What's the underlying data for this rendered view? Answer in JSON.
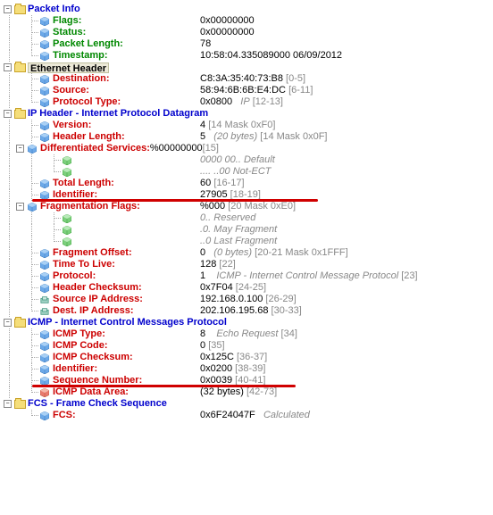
{
  "packet_info": {
    "title": "Packet Info",
    "flags": {
      "label": "Flags:",
      "value": "0x00000000"
    },
    "status": {
      "label": "Status:",
      "value": "0x00000000"
    },
    "length": {
      "label": "Packet Length:",
      "value": "78"
    },
    "ts": {
      "label": "Timestamp:",
      "value": "10:58:04.335089000 06/09/2012"
    }
  },
  "ethernet": {
    "title": "Ethernet Header",
    "dest": {
      "label": "Destination:",
      "value": "C8:3A:35:40:73:B8",
      "range": "[0-5]"
    },
    "src": {
      "label": "Source:",
      "value": "58:94:6B:6B:E4:DC",
      "range": "[6-11]"
    },
    "ptype": {
      "label": "Protocol Type:",
      "value": "0x0800",
      "extra": "IP",
      "range": "[12-13]"
    }
  },
  "ip": {
    "title": "IP Header - Internet Protocol Datagram",
    "version": {
      "label": "Version:",
      "value": "4",
      "range": "[14 Mask 0xF0]"
    },
    "hlen": {
      "label": "Header Length:",
      "value": "5",
      "extra": "(20 bytes)",
      "range": "[14 Mask 0x0F]"
    },
    "dserv": {
      "label": "Differentiated Services:",
      "value": "%00000000",
      "range": "[15]"
    },
    "ds1": {
      "bits": "0000 00..",
      "desc": "Default"
    },
    "ds2": {
      "bits": ".... ..00",
      "desc": "Not-ECT"
    },
    "tlen": {
      "label": "Total Length:",
      "value": "60",
      "range": "[16-17]"
    },
    "ident": {
      "label": "Identifier:",
      "value": "27905",
      "range": "[18-19]"
    },
    "fflags": {
      "label": "Fragmentation Flags:",
      "value": "%000",
      "range": "[20 Mask 0xE0]"
    },
    "ff1": {
      "bits": "0..",
      "desc": "Reserved"
    },
    "ff2": {
      "bits": ".0.",
      "desc": "May Fragment"
    },
    "ff3": {
      "bits": "..0",
      "desc": "Last Fragment"
    },
    "foff": {
      "label": "Fragment Offset:",
      "value": "0",
      "extra": "(0 bytes)",
      "range": "[20-21 Mask 0x1FFF]"
    },
    "ttl": {
      "label": "Time To Live:",
      "value": "128",
      "range": "[22]"
    },
    "proto": {
      "label": "Protocol:",
      "value": "1",
      "extra": "ICMP - Internet Control Message Protocol",
      "range": "[23]"
    },
    "hchk": {
      "label": "Header Checksum:",
      "value": "0x7F04",
      "range": "[24-25]"
    },
    "srcip": {
      "label": "Source IP Address:",
      "value": "192.168.0.100",
      "range": "[26-29]"
    },
    "dstip": {
      "label": "Dest. IP Address:",
      "value": "202.106.195.68",
      "range": "[30-33]"
    }
  },
  "icmp": {
    "title": "ICMP - Internet Control Messages Protocol",
    "type": {
      "label": "ICMP Type:",
      "value": "8",
      "extra": "Echo Request",
      "range": "[34]"
    },
    "code": {
      "label": "ICMP Code:",
      "value": "0",
      "range": "[35]"
    },
    "chk": {
      "label": "ICMP Checksum:",
      "value": "0x125C",
      "range": "[36-37]"
    },
    "ident": {
      "label": "Identifier:",
      "value": "0x0200",
      "range": "[38-39]"
    },
    "seq": {
      "label": "Sequence Number:",
      "value": "0x0039",
      "range": "[40-41]"
    },
    "data": {
      "label": "ICMP Data Area:",
      "value": "(32 bytes)",
      "range": "[42-73]"
    }
  },
  "fcs": {
    "title": "FCS - Frame Check Sequence",
    "fcs": {
      "label": "FCS:",
      "value": "0x6F24047F",
      "extra": "Calculated"
    }
  }
}
